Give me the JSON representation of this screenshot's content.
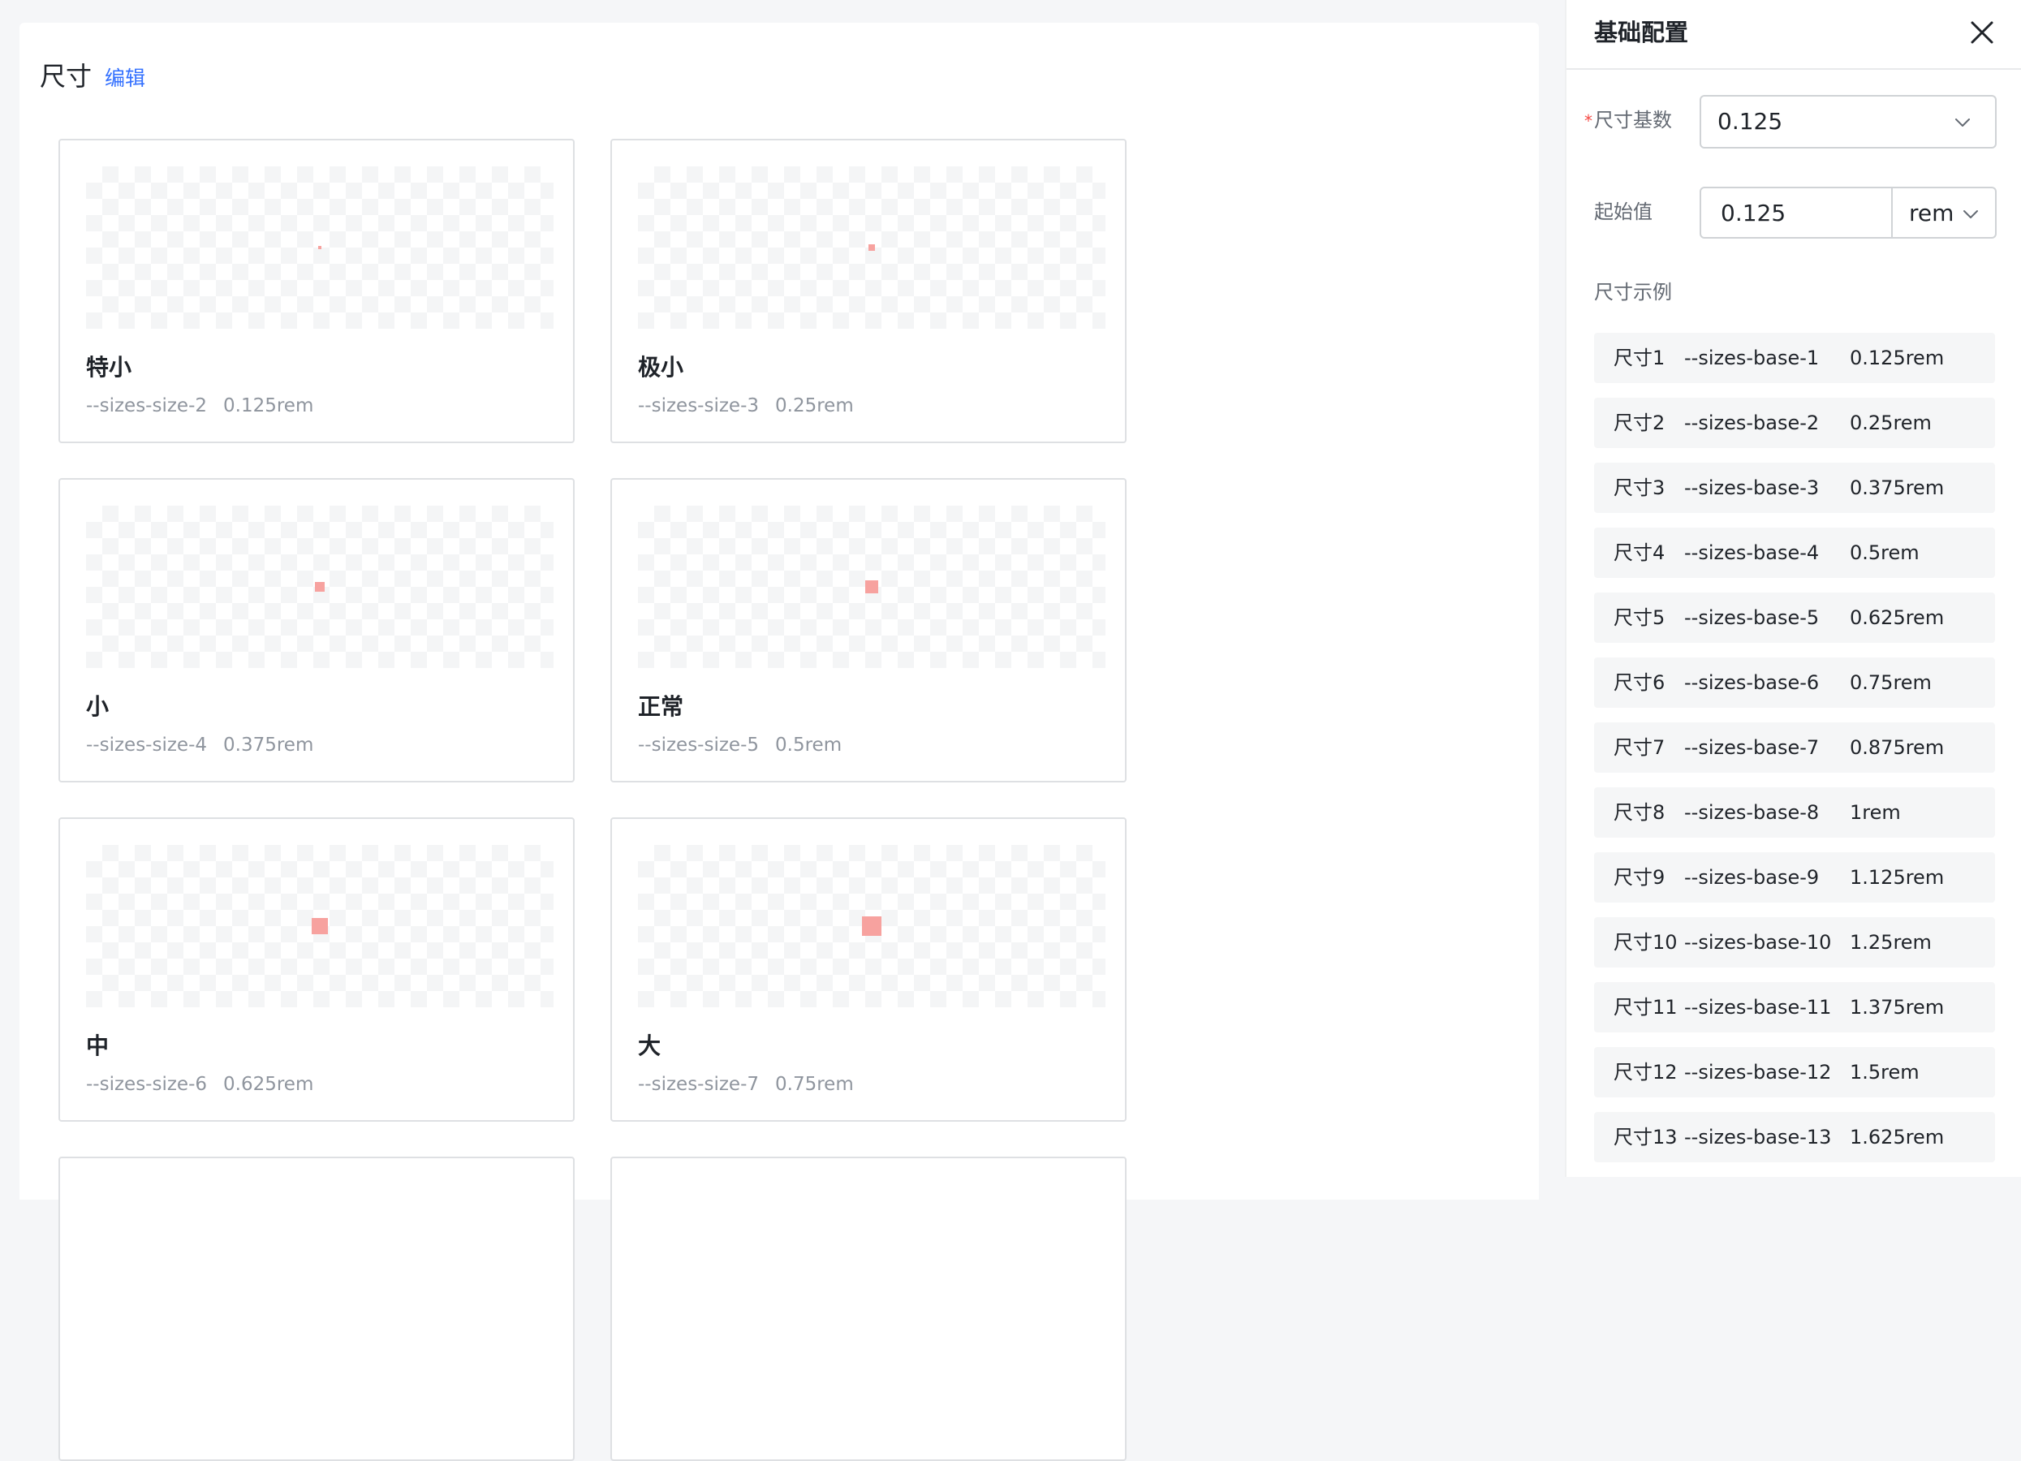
{
  "main": {
    "section_title": "尺寸",
    "edit_label": "编辑",
    "cards": [
      {
        "name": "特小",
        "var": "--sizes-size-2",
        "value": "0.125rem"
      },
      {
        "name": "极小",
        "var": "--sizes-size-3",
        "value": "0.25rem"
      },
      {
        "name": "小",
        "var": "--sizes-size-4",
        "value": "0.375rem"
      },
      {
        "name": "正常",
        "var": "--sizes-size-5",
        "value": "0.5rem"
      },
      {
        "name": "中",
        "var": "--sizes-size-6",
        "value": "0.625rem"
      },
      {
        "name": "大",
        "var": "--sizes-size-7",
        "value": "0.75rem"
      }
    ]
  },
  "panel": {
    "title": "基础配置",
    "base_label": "尺寸基数",
    "base_required_mark": "*",
    "base_value": "0.125",
    "start_label": "起始值",
    "start_value": "0.125",
    "unit_value": "rem",
    "examples_label": "尺寸示例",
    "examples": [
      {
        "name": "尺寸1",
        "var": "--sizes-base-1",
        "value": "0.125rem"
      },
      {
        "name": "尺寸2",
        "var": "--sizes-base-2",
        "value": "0.25rem"
      },
      {
        "name": "尺寸3",
        "var": "--sizes-base-3",
        "value": "0.375rem"
      },
      {
        "name": "尺寸4",
        "var": "--sizes-base-4",
        "value": "0.5rem"
      },
      {
        "name": "尺寸5",
        "var": "--sizes-base-5",
        "value": "0.625rem"
      },
      {
        "name": "尺寸6",
        "var": "--sizes-base-6",
        "value": "0.75rem"
      },
      {
        "name": "尺寸7",
        "var": "--sizes-base-7",
        "value": "0.875rem"
      },
      {
        "name": "尺寸8",
        "var": "--sizes-base-8",
        "value": "1rem"
      },
      {
        "name": "尺寸9",
        "var": "--sizes-base-9",
        "value": "1.125rem"
      },
      {
        "name": "尺寸10",
        "var": "--sizes-base-10",
        "value": "1.25rem"
      },
      {
        "name": "尺寸11",
        "var": "--sizes-base-11",
        "value": "1.375rem"
      },
      {
        "name": "尺寸12",
        "var": "--sizes-base-12",
        "value": "1.5rem"
      },
      {
        "name": "尺寸13",
        "var": "--sizes-base-13",
        "value": "1.625rem"
      }
    ]
  },
  "colors": {
    "swatch": "#f7a29f",
    "link": "#3370ff",
    "required": "#f54a45"
  }
}
